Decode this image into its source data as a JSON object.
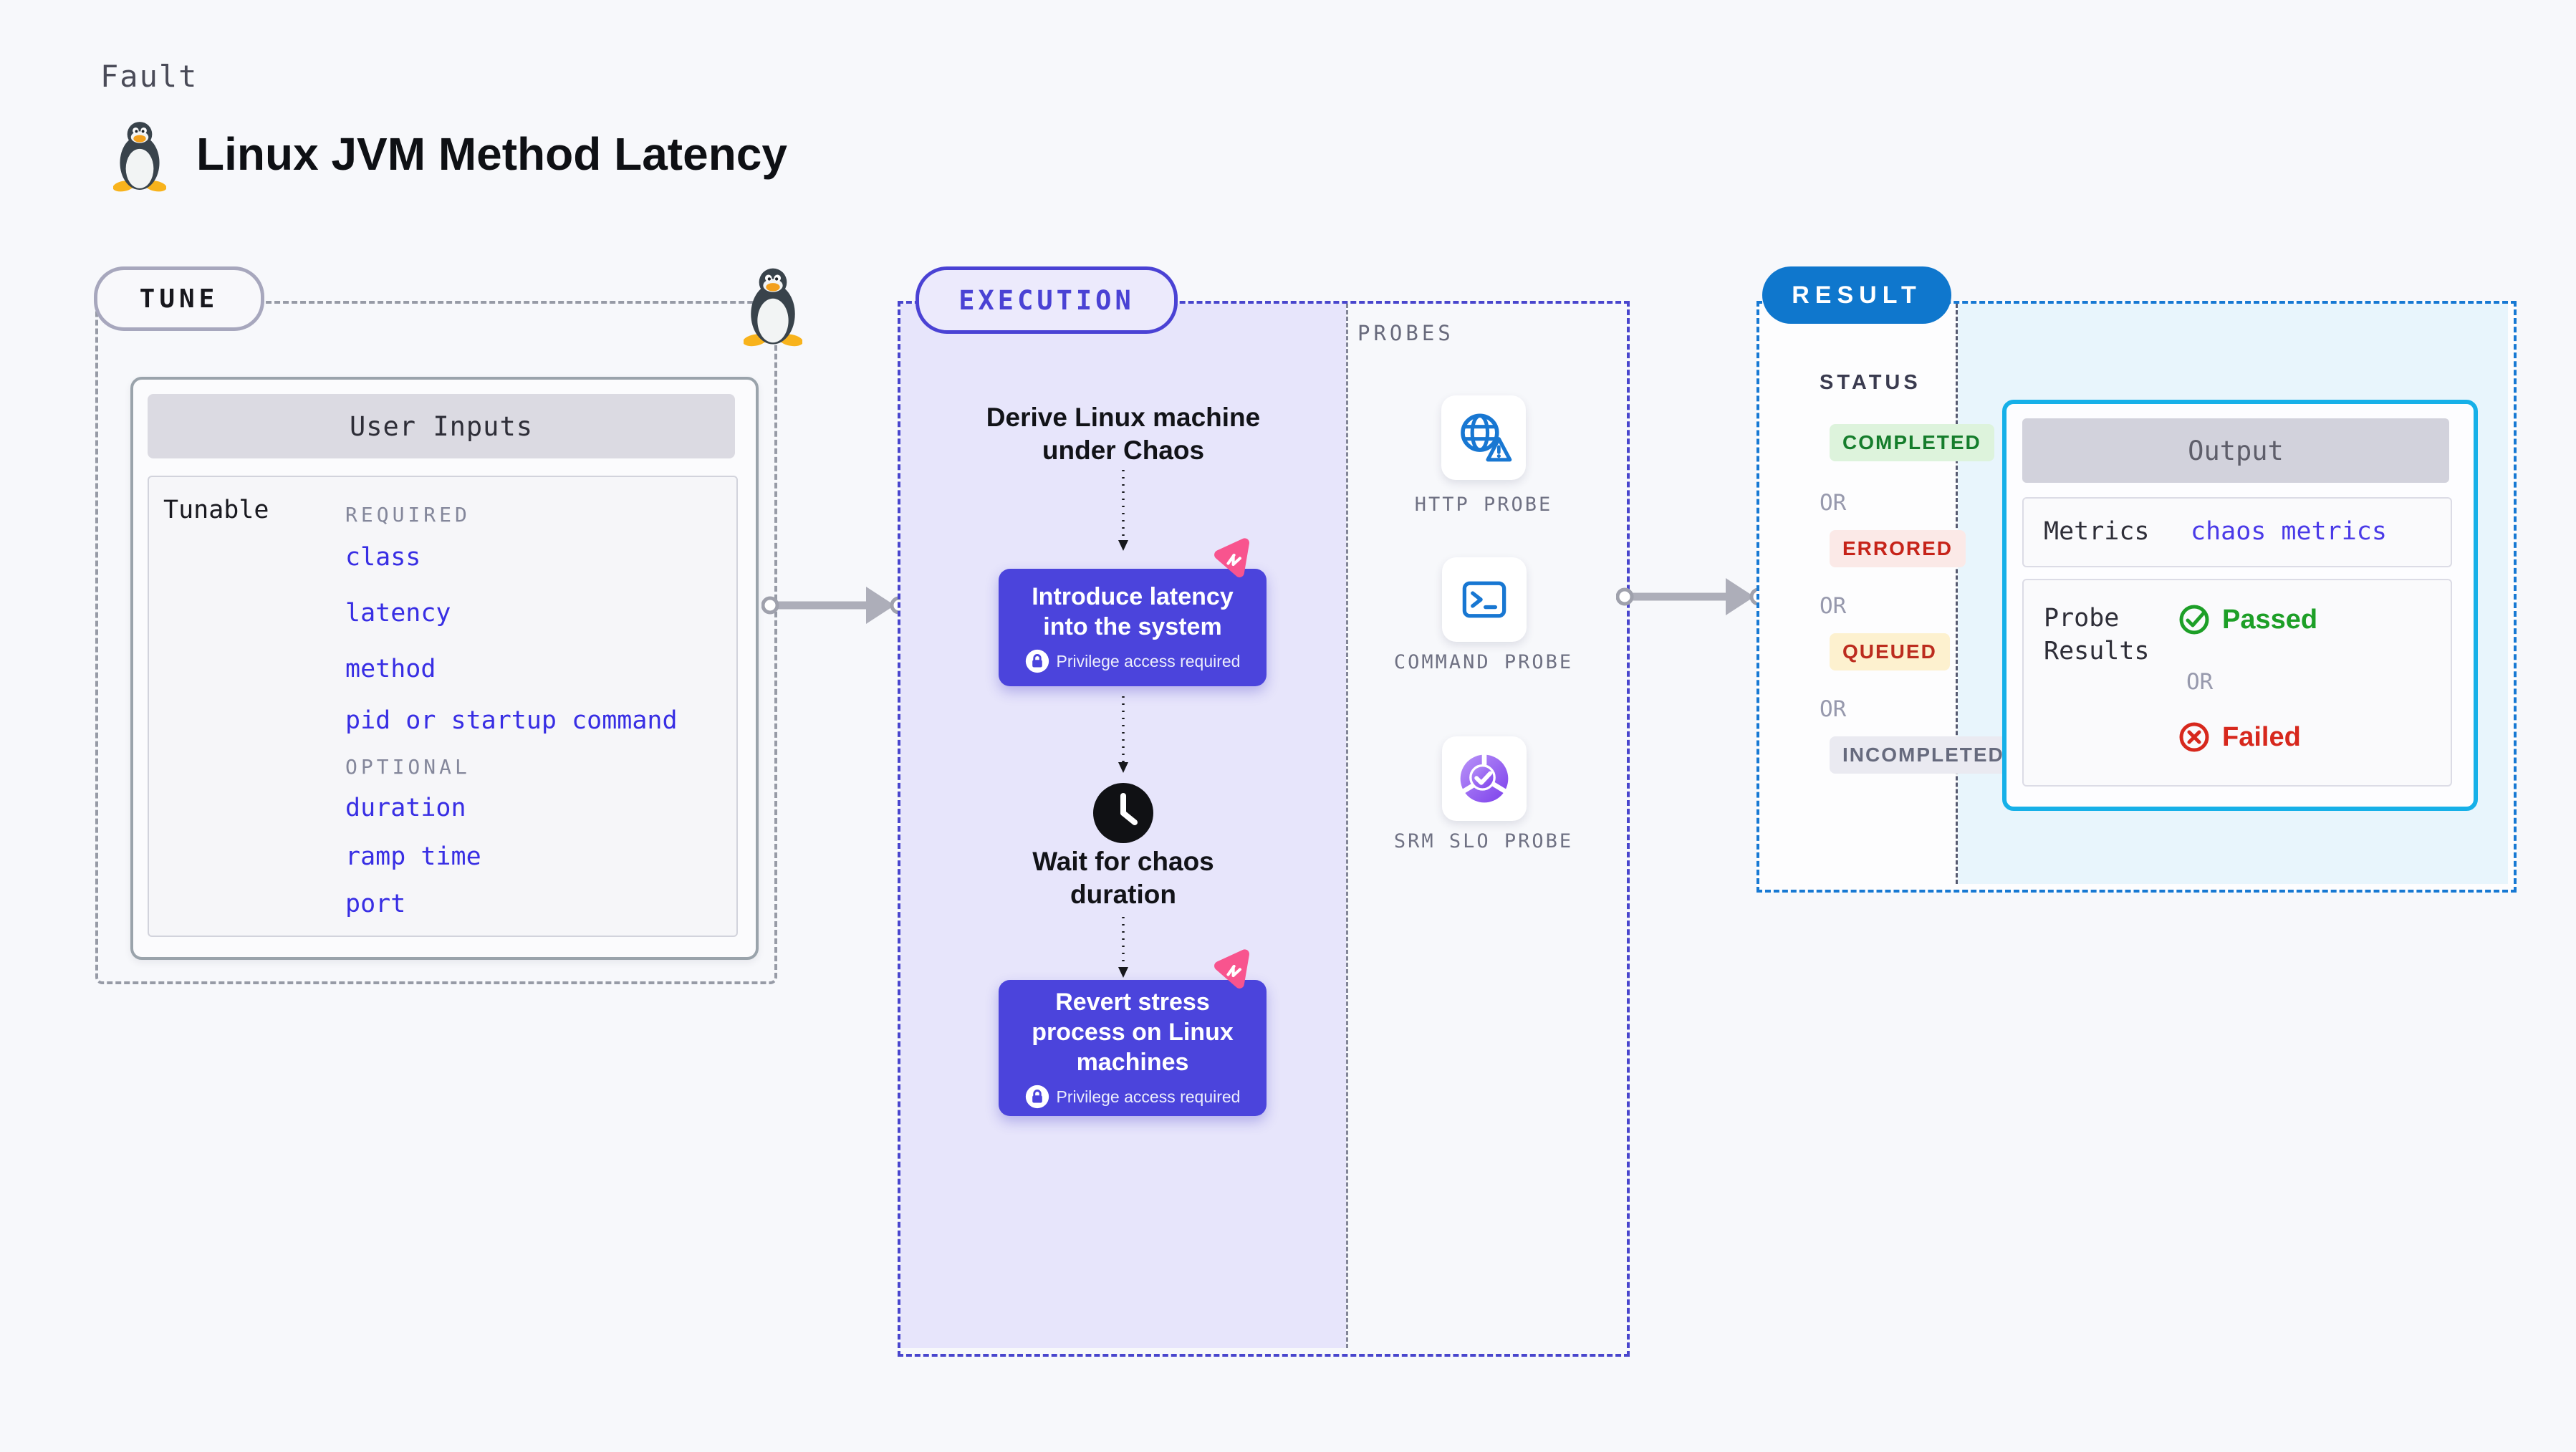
{
  "header": {
    "kicker": "Fault",
    "title": "Linux JVM Method Latency",
    "logo_icon": "tux-penguin-icon"
  },
  "tune": {
    "badge": "TUNE",
    "corner_icon": "tux-penguin-icon",
    "card_title": "User Inputs",
    "row_label": "Tunable",
    "required_label": "REQUIRED",
    "required_items": [
      "class",
      "latency",
      "method",
      "pid or startup command"
    ],
    "optional_label": "OPTIONAL",
    "optional_items": [
      "duration",
      "ramp time",
      "port"
    ]
  },
  "execution": {
    "badge": "EXECUTION",
    "derive_step": "Derive Linux machine under Chaos",
    "introduce_step": "Introduce latency into the system",
    "wait_step": "Wait for chaos duration",
    "revert_step": "Revert stress process on Linux machines",
    "privilege_note": "Privilege access required",
    "icons": {
      "introduce": "chaos-badge-icon",
      "wait": "clock-icon",
      "revert": "chaos-badge-icon",
      "privilege": "lock-icon"
    }
  },
  "probes": {
    "label": "PROBES",
    "items": [
      {
        "name": "HTTP PROBE",
        "icon": "globe-alert-icon"
      },
      {
        "name": "COMMAND PROBE",
        "icon": "terminal-icon"
      },
      {
        "name": "SRM SLO PROBE",
        "icon": "slo-gauge-icon"
      }
    ]
  },
  "result": {
    "badge": "RESULT",
    "status_label": "STATUS",
    "or_label": "OR",
    "statuses": [
      {
        "label": "COMPLETED",
        "text_color": "#157d2c",
        "bg_color": "#ddf3dc"
      },
      {
        "label": "ERRORED",
        "text_color": "#c62319",
        "bg_color": "#fbe9e7"
      },
      {
        "label": "QUEUED",
        "text_color": "#bc2c1e",
        "bg_color": "#fdf1cf"
      },
      {
        "label": "INCOMPLETED",
        "text_color": "#666a7d",
        "bg_color": "#eaeaf1"
      }
    ],
    "output": {
      "title": "Output",
      "metrics_label": "Metrics",
      "metrics_value": "chaos metrics",
      "probe_results_label": "Probe Results",
      "passed_label": "Passed",
      "failed_label": "Failed",
      "passed_icon": "check-circle-icon",
      "failed_icon": "x-circle-icon"
    }
  },
  "colors": {
    "indigo_accent": "#4b44dc",
    "purple_panel": "#e7e5fb",
    "pink_badge": "#f8548e",
    "result_blue": "#0f77cd",
    "output_border_cyan": "#16b0e8",
    "probe_icon_blue": "#1877d2",
    "passed_green": "#1d9f27",
    "failed_red": "#d7281d",
    "page_background": "#f7f8fb"
  }
}
